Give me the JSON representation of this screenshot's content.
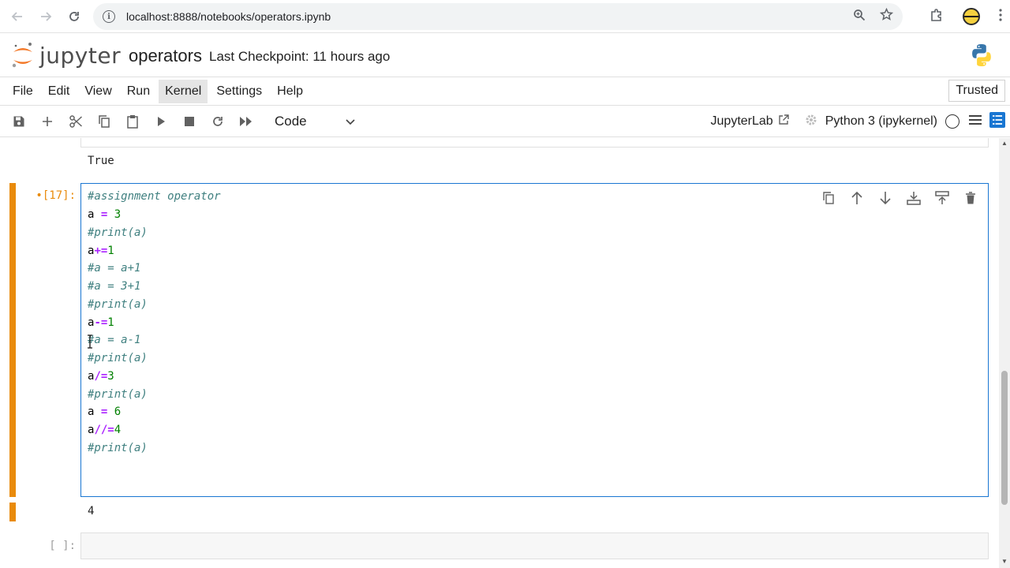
{
  "browser": {
    "url": "localhost:8888/notebooks/operators.ipynb",
    "icons": [
      "back-icon",
      "forward-icon",
      "reload-icon",
      "info-icon",
      "zoom-icon",
      "star-icon",
      "extensions-icon",
      "avatar",
      "menu-icon"
    ]
  },
  "header": {
    "logo_text": "jupyter",
    "notebook_title": "operators",
    "checkpoint": "Last Checkpoint: 11 hours ago"
  },
  "menu": {
    "items": [
      "File",
      "Edit",
      "View",
      "Run",
      "Kernel",
      "Settings",
      "Help"
    ],
    "active": "Kernel",
    "trusted": "Trusted"
  },
  "toolbar": {
    "cell_type": "Code",
    "jupyterlab_label": "JupyterLab",
    "kernel_name": "Python 3 (ipykernel)"
  },
  "notebook": {
    "prev_output": "True",
    "active_cell": {
      "prompt": "•[17]:",
      "lines": [
        "#assignment operator",
        "a = 3",
        "#print(a)",
        "a+=1",
        "#a = a+1",
        "#a = 3+1",
        "#print(a)",
        "a-=1",
        "#a = a-1",
        "#print(a)",
        "a/=3",
        "#print(a)",
        "a = 6",
        "a//=4",
        "#print(a)"
      ],
      "output": "4"
    },
    "next_cell": {
      "prompt": "[ ]:"
    }
  },
  "colors": {
    "accent": "#1976d2",
    "collapser": "#e98b0c",
    "comment": "#408080",
    "operator": "#aa22ff",
    "number": "#008000"
  }
}
